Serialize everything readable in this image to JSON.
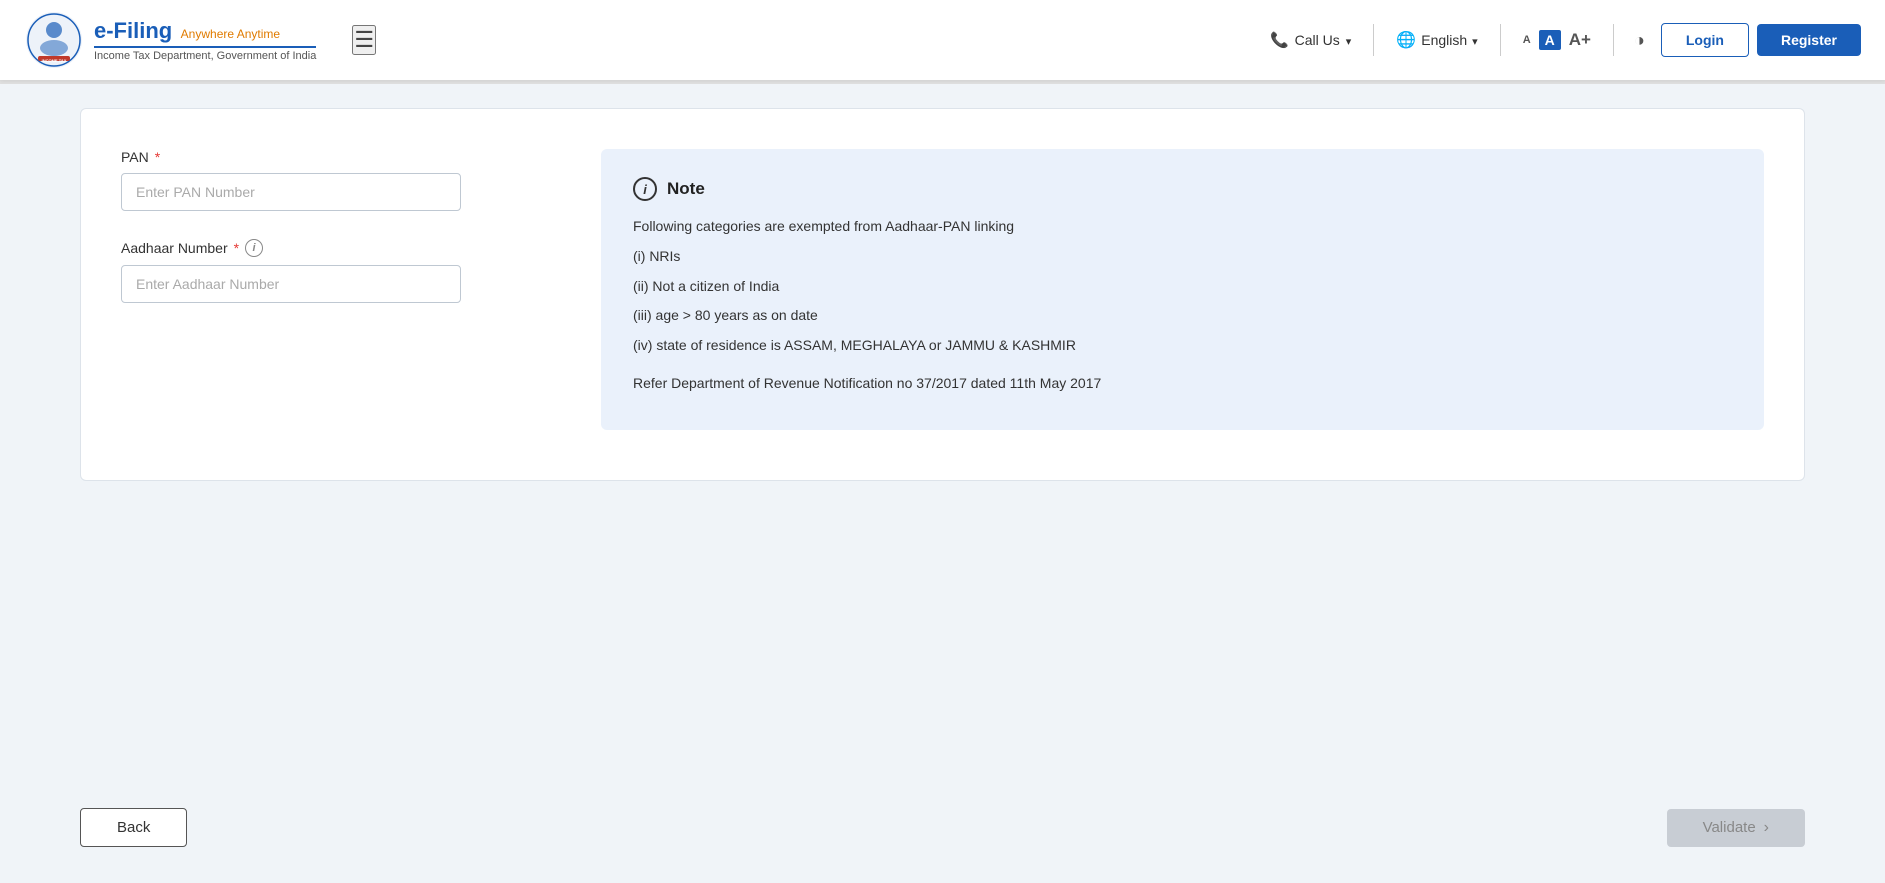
{
  "header": {
    "logo_title": "e-Filing",
    "logo_tagline": "Anywhere Anytime",
    "logo_subtitle": "Income Tax Department, Government of India",
    "hamburger_icon": "☰",
    "call_us_label": "Call Us",
    "language_label": "English",
    "font_small_label": "A",
    "font_medium_label": "A",
    "font_large_label": "A+",
    "contrast_icon": "◑",
    "login_label": "Login",
    "register_label": "Register"
  },
  "form": {
    "pan_label": "PAN",
    "pan_placeholder": "Enter PAN Number",
    "aadhaar_label": "Aadhaar Number",
    "aadhaar_placeholder": "Enter Aadhaar Number"
  },
  "note": {
    "title": "Note",
    "body_intro": "Following categories are exempted from Aadhaar-PAN linking",
    "item1": "(i) NRIs",
    "item2": "(ii) Not a citizen of India",
    "item3": "(iii) age > 80 years as on date",
    "item4": "(iv) state of residence is ASSAM, MEGHALAYA or JAMMU & KASHMIR",
    "reference": "Refer Department of Revenue Notification no 37/2017 dated 11th May 2017"
  },
  "actions": {
    "back_label": "Back",
    "validate_label": "Validate"
  }
}
